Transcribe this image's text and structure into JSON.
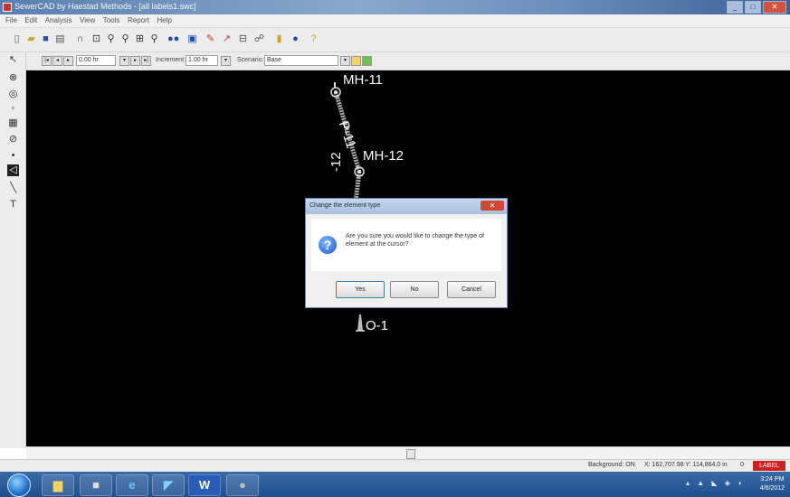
{
  "window": {
    "title": "SewerCAD by Haestad Methods - [all labels1.swc]",
    "buttons": [
      "_",
      "□",
      "✕"
    ]
  },
  "menu": [
    "File",
    "Edit",
    "Analysis",
    "View",
    "Tools",
    "Report",
    "Help"
  ],
  "toolbar1": {
    "icons": [
      "new-icon",
      "open-icon",
      "save-icon",
      "print-icon",
      "pan-icon",
      "zoom-window-icon",
      "zoom-in-icon",
      "zoom-out-icon",
      "zoom-extents-icon",
      "zoom-previous-icon",
      "binoculars-icon",
      "element-icon",
      "annotate-icon",
      "profile-icon",
      "graph-icon",
      "flex-table-icon",
      "database-icon",
      "globe-icon",
      "help-icon"
    ]
  },
  "toolbar2": {
    "time_value": "0.00 hr",
    "increment_label": "Increment:",
    "increment_value": "1.00 hr",
    "scenario_label": "Scenario:",
    "scenario_value": "Base"
  },
  "drawing": {
    "labels": [
      "MH-11",
      "P-11",
      "MH-12",
      "-12",
      "O-1"
    ]
  },
  "dialog": {
    "title": "Change the element type",
    "message": "Are you sure you would like to change the type of element at the cursor?",
    "buttons": {
      "yes": "Yes",
      "no": "No",
      "cancel": "Cancel"
    }
  },
  "status": {
    "background": "Background: ON",
    "coords": "X: 162,707.98  Y: 114,864.0 in",
    "zero": "0",
    "badge": "LABEL"
  },
  "taskbar": {
    "apps": [
      "explorer",
      "folder",
      "media",
      "ie",
      "sewercad",
      "word",
      "app"
    ],
    "clock_time": "3:24 PM",
    "clock_date": "4/6/2012"
  },
  "colors": {
    "canvas": "#000000",
    "pipe": "#bfbfbf",
    "label": "#ffffff"
  }
}
